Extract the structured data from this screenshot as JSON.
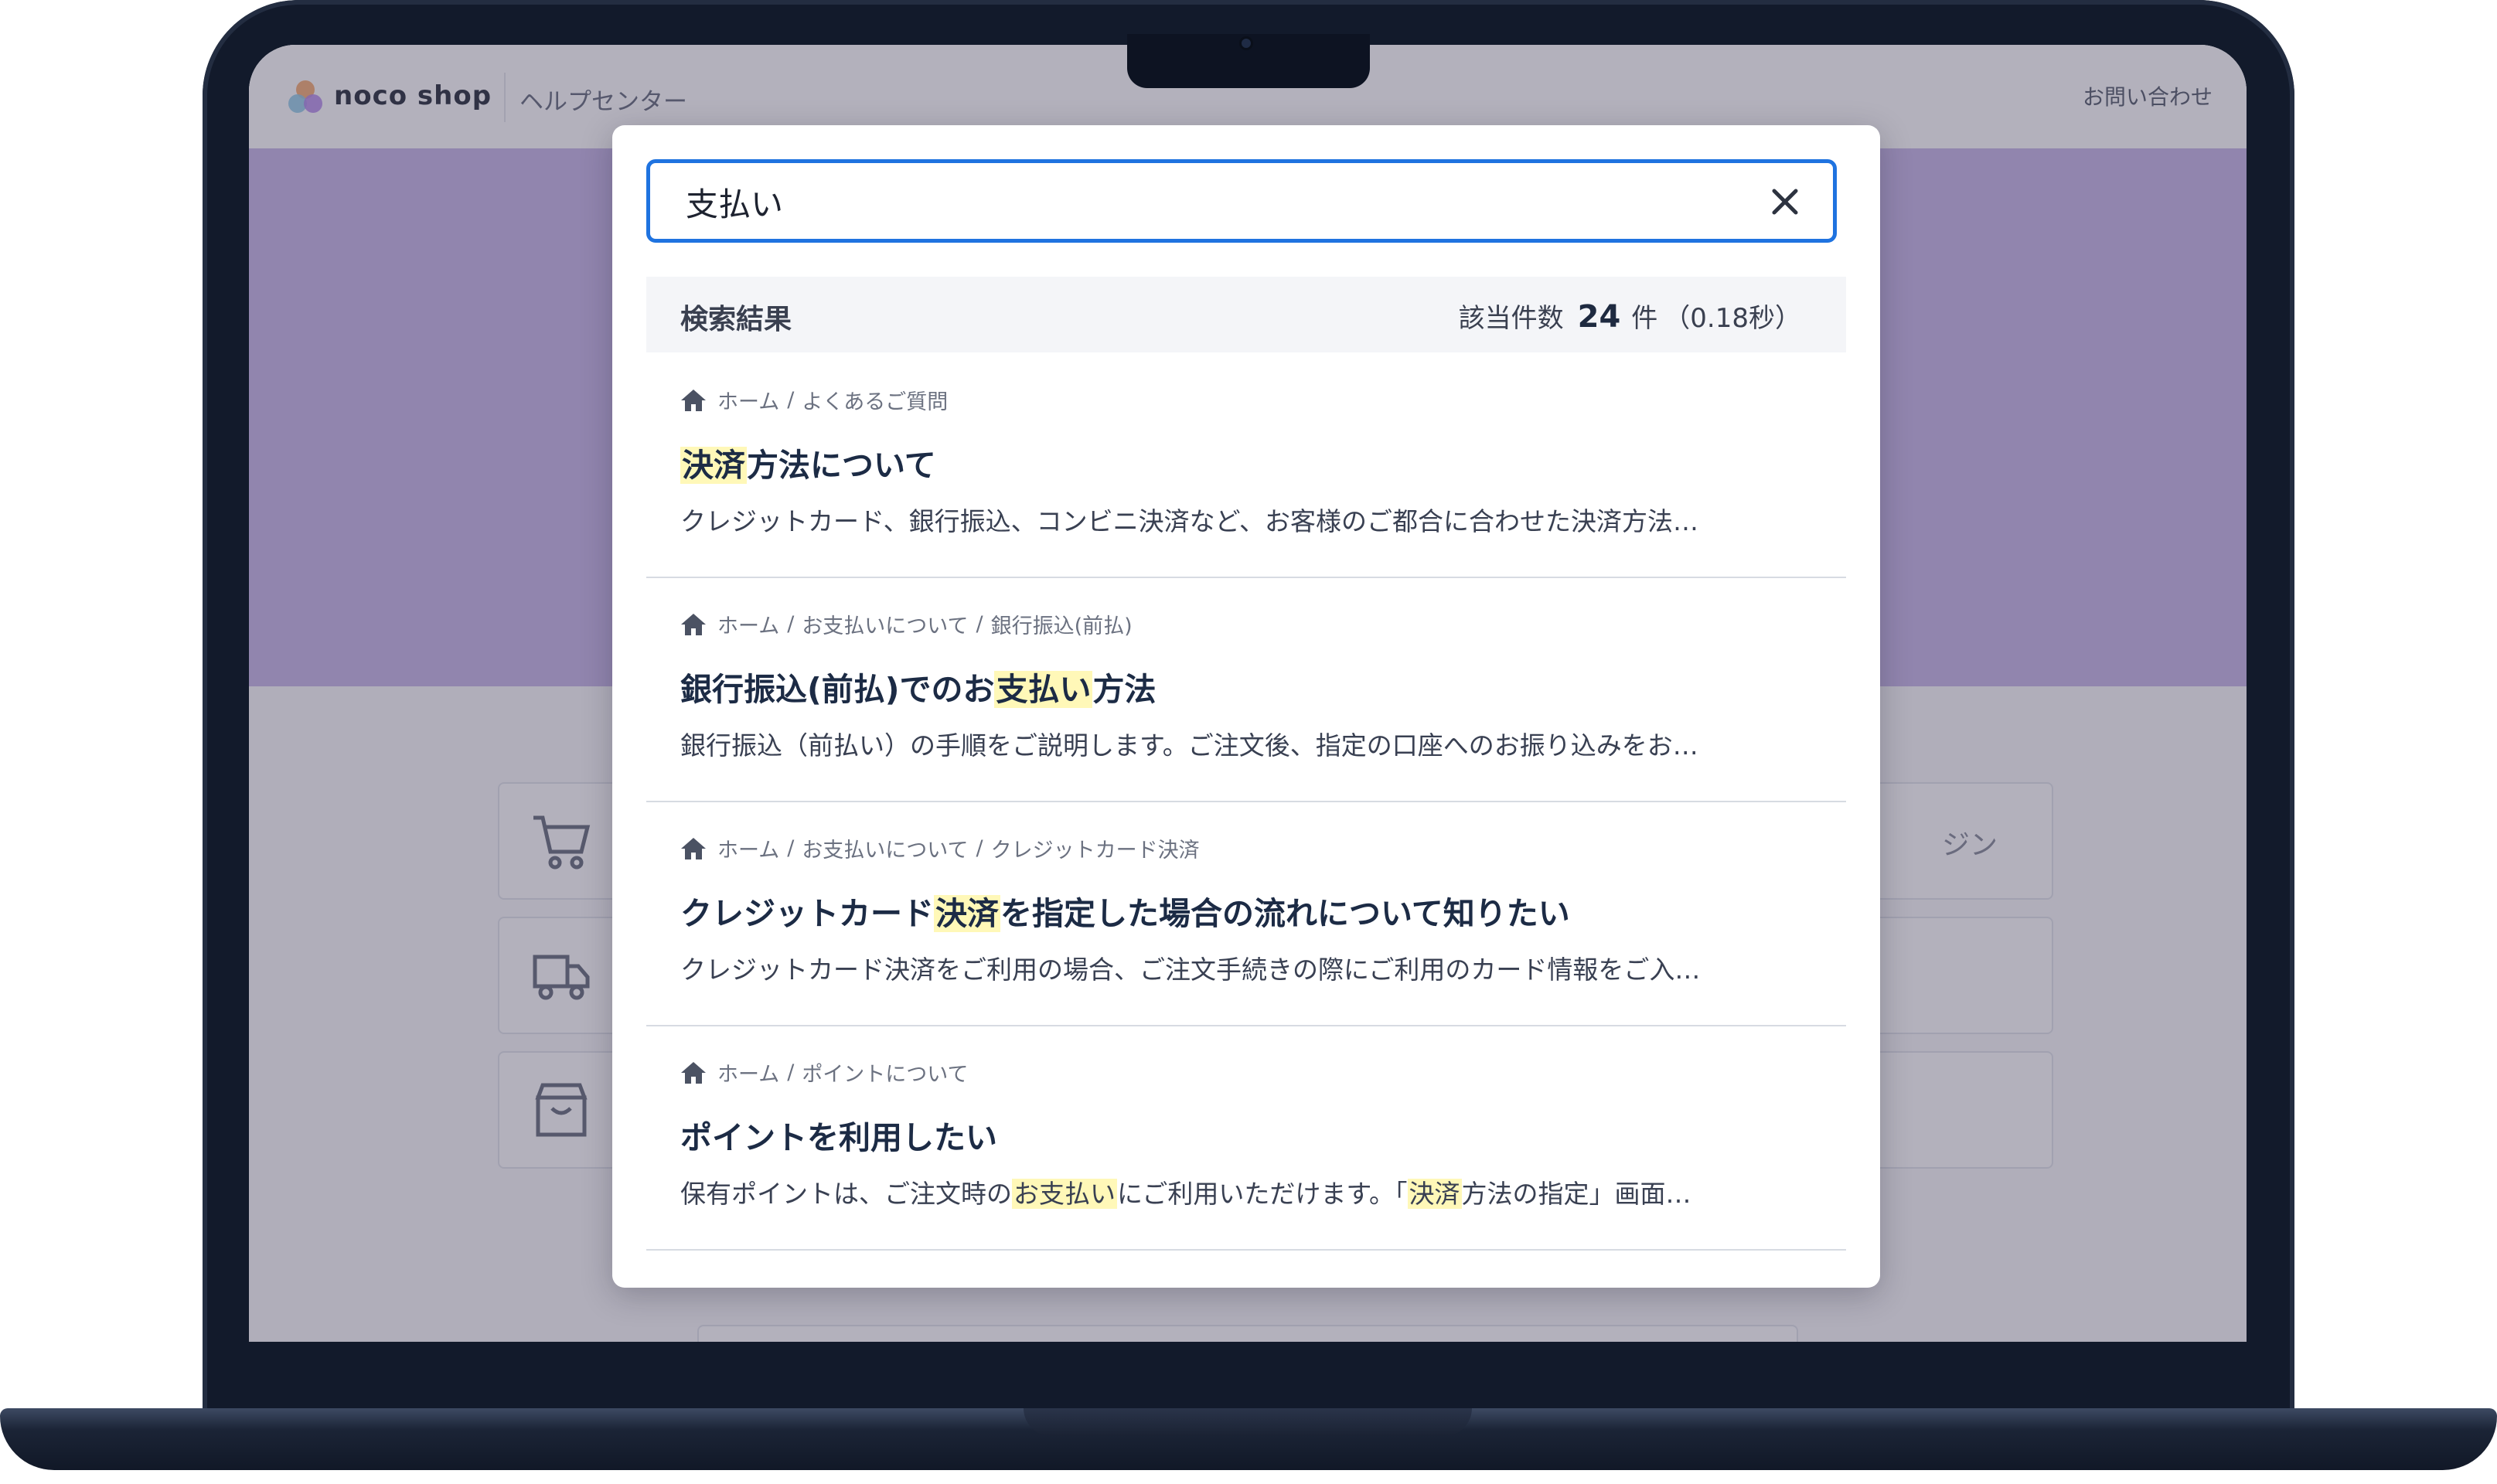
{
  "site": {
    "logo_text": "noco shop",
    "section_title": "ヘルプセンター",
    "contact_link": "お問い合わせ"
  },
  "background": {
    "login_fragment": "ジン"
  },
  "search": {
    "query": "支払い"
  },
  "results": {
    "label": "検索結果",
    "count_prefix": "該当件数",
    "count": "24",
    "count_unit": "件",
    "elapsed": "（0.18秒）",
    "items": [
      {
        "breadcrumb": [
          "ホーム",
          "よくあるご質問"
        ],
        "title_pre": "",
        "title_hl": "決済",
        "title_post": "方法について",
        "snippet_pre": "クレジットカード、銀行振込、コンビニ決済など、お客様のご都合に合わせた決済方法…",
        "snippet_hl1": "",
        "snippet_mid": "",
        "snippet_hl2": "",
        "snippet_post": ""
      },
      {
        "breadcrumb": [
          "ホーム",
          "お支払いについて",
          "銀行振込(前払)"
        ],
        "title_pre": "銀行振込(前払)でのお",
        "title_hl": "支払い",
        "title_post": "方法",
        "snippet_pre": "銀行振込（前払い）の手順をご説明します。ご注文後、指定の口座へのお振り込みをお…",
        "snippet_hl1": "",
        "snippet_mid": "",
        "snippet_hl2": "",
        "snippet_post": ""
      },
      {
        "breadcrumb": [
          "ホーム",
          "お支払いについて",
          "クレジットカード決済"
        ],
        "title_pre": "クレジットカード",
        "title_hl": "決済",
        "title_post": "を指定した場合の流れについて知りたい",
        "snippet_pre": "クレジットカード決済をご利用の場合、ご注文手続きの際にご利用のカード情報をご入…",
        "snippet_hl1": "",
        "snippet_mid": "",
        "snippet_hl2": "",
        "snippet_post": ""
      },
      {
        "breadcrumb": [
          "ホーム",
          "ポイントについて"
        ],
        "title_pre": "ポイントを利用したい",
        "title_hl": "",
        "title_post": "",
        "snippet_pre": "保有ポイントは、ご注文時の",
        "snippet_hl1": "お支払い",
        "snippet_mid": "にご利用いただけます。「",
        "snippet_hl2": "決済",
        "snippet_post": "方法の指定」画面…"
      }
    ]
  },
  "colors": {
    "accent": "#1f73e0",
    "highlight": "#fff8b8",
    "hero": "#c8b9e8",
    "title": "#1c2b45"
  },
  "icons": [
    "home-icon",
    "close-icon",
    "cart-icon",
    "truck-icon",
    "bag-icon"
  ]
}
